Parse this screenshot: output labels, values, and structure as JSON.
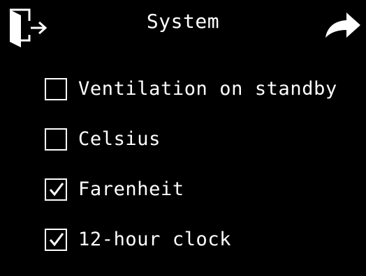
{
  "header": {
    "title": "System",
    "left_icon": "exit-door-icon",
    "right_icon": "forward-arrow-icon"
  },
  "options": [
    {
      "label": "Ventilation on standby",
      "checked": false
    },
    {
      "label": "Celsius",
      "checked": false
    },
    {
      "label": "Farenheit",
      "checked": true
    },
    {
      "label": "12-hour clock",
      "checked": true
    }
  ],
  "colors": {
    "background": "#000000",
    "foreground": "#ffffff"
  }
}
